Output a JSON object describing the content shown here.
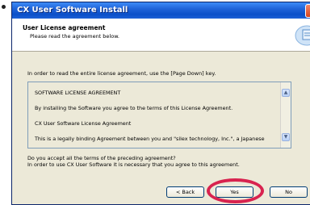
{
  "window": {
    "title": "CX User Software Install"
  },
  "header": {
    "title": "User License agreement",
    "subtitle": "Please read the agreement below."
  },
  "instruction": "In order to read the entire license agreement, use the [Page Down] key.",
  "license": {
    "lines": [
      "SOFTWARE LICENSE AGREEMENT",
      "By installing the Software you agree to the terms of this License Agreement.",
      "CX User Software License Agreement",
      "This is a legally binding Agreement between you and \"silex technology, Inc.\", a Japanese"
    ]
  },
  "question": {
    "line1": "Do you accept all the terms of the preceding agreement?",
    "line2": "In order to use CX User Software it is necessary that you agree to this agreement."
  },
  "buttons": {
    "back": "< Back",
    "yes": "Yes",
    "no": "No"
  },
  "icons": {
    "scroll_up": "scroll-up-arrow-icon",
    "scroll_down": "scroll-down-arrow-icon",
    "header_graphic": "installer-graphic-icon"
  },
  "colors": {
    "highlight_ring": "#d8234f",
    "titlebar": "#0a4fc9"
  }
}
